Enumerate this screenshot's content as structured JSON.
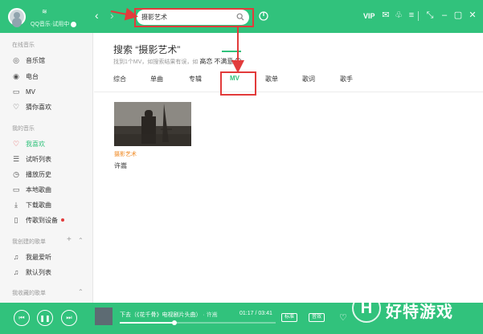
{
  "colors": {
    "brand_green": "#31c27c",
    "annotation_red": "#e23b3b",
    "mv_title_orange": "#f08a24"
  },
  "header": {
    "user_status": "QQ音乐·试用中",
    "search_value": "摄影艺术",
    "vip_label": "VIP",
    "nav_back_icon": "chevron-left-icon",
    "nav_forward_icon": "chevron-right-icon",
    "right_icons": [
      "mail-icon",
      "skin-icon",
      "settings-icon",
      "mini-mode-icon",
      "minimize-icon",
      "maximize-icon",
      "close-icon"
    ]
  },
  "sidebar": {
    "sections": [
      {
        "title": "在线音乐",
        "items": [
          {
            "label": "音乐馆",
            "icon": "music-hall-icon"
          },
          {
            "label": "电台",
            "icon": "radio-icon"
          },
          {
            "label": "MV",
            "icon": "mv-icon"
          },
          {
            "label": "猜你喜欢",
            "icon": "heart-outline-icon"
          }
        ]
      },
      {
        "title": "我的音乐",
        "items": [
          {
            "label": "我喜欢",
            "icon": "heart-icon",
            "active": true
          },
          {
            "label": "试听列表",
            "icon": "list-icon"
          },
          {
            "label": "播放历史",
            "icon": "history-icon"
          },
          {
            "label": "本地歌曲",
            "icon": "computer-icon"
          },
          {
            "label": "下载歌曲",
            "icon": "download-icon"
          },
          {
            "label": "传歌到设备",
            "icon": "device-icon",
            "badge_dot": true
          }
        ]
      },
      {
        "title": "我创建的歌单",
        "items": [
          {
            "label": "我最爱听",
            "icon": "playlist-icon"
          },
          {
            "label": "默认列表",
            "icon": "playlist-icon"
          }
        ]
      },
      {
        "title": "我收藏的歌单",
        "items": []
      }
    ]
  },
  "search_results": {
    "title_prefix": "搜索",
    "query_display": "“摄影艺术”",
    "summary_prefix": "找到1个MV，如搜索结果有误，如",
    "summary_term": "高恋",
    "summary_not_term": "不满意",
    "summary_tail": "的",
    "tabs": [
      "综合",
      "单曲",
      "专辑",
      "MV",
      "歌单",
      "歌词",
      "歌手"
    ],
    "active_tab": "MV",
    "mv_items": [
      {
        "title": "摄影艺术",
        "artist": "许嵩"
      }
    ]
  },
  "player": {
    "track_title": "下去（《花千骨》电视剧片头曲）",
    "track_separator": "·",
    "track_artist": "许嵩",
    "time_current": "01:17",
    "time_total": "03:41",
    "progress_fraction": 0.35,
    "quality_label": "标准",
    "effect_label": "音效",
    "controls": [
      "previous-icon",
      "pause-icon",
      "next-icon"
    ],
    "right_icons": [
      "favorite-icon",
      "volume-icon",
      "lyrics-icon",
      "playlist-icon"
    ]
  },
  "watermark": {
    "logo_letter": "H",
    "text": "好特游戏"
  }
}
